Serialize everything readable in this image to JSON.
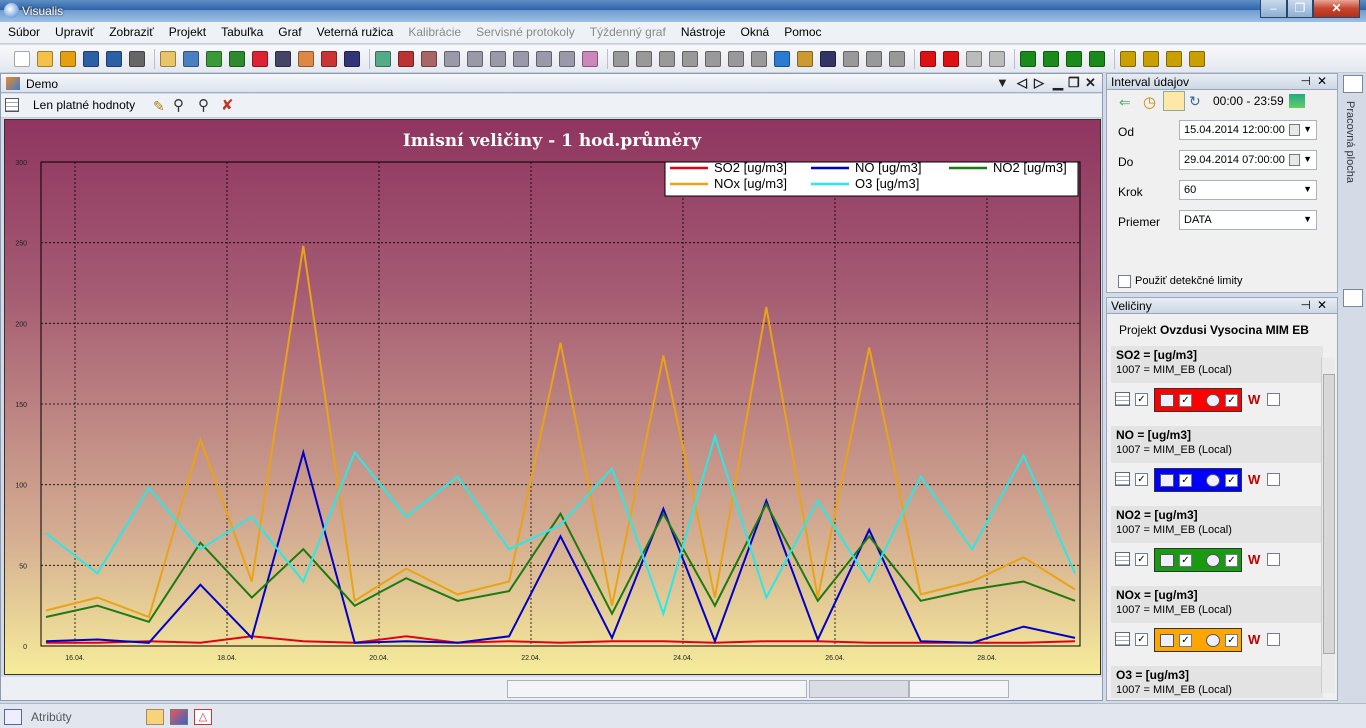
{
  "window": {
    "title": "Visualis"
  },
  "menu": [
    {
      "label": "Súbor",
      "disabled": false
    },
    {
      "label": "Upraviť",
      "disabled": false
    },
    {
      "label": "Zobraziť",
      "disabled": false
    },
    {
      "label": "Projekt",
      "disabled": false
    },
    {
      "label": "Tabuľka",
      "disabled": false
    },
    {
      "label": "Graf",
      "disabled": false
    },
    {
      "label": "Veterná ružica",
      "disabled": false
    },
    {
      "label": "Kalibrácie",
      "disabled": true
    },
    {
      "label": "Servisné protokoly",
      "disabled": true
    },
    {
      "label": "Týždenný graf",
      "disabled": true
    },
    {
      "label": "Nástroje",
      "disabled": false
    },
    {
      "label": "Okná",
      "disabled": false
    },
    {
      "label": "Pomoc",
      "disabled": false
    }
  ],
  "document": {
    "title": "Demo",
    "valid_only_label": "Len platné hodnoty"
  },
  "chart_data": {
    "type": "line",
    "title": "Imisní veličiny - 1 hod.průměry",
    "ylim": [
      0,
      300
    ],
    "yticks": [
      0,
      50,
      100,
      150,
      200,
      250,
      300
    ],
    "xticks": [
      "16.04.",
      "18.04.",
      "20.04.",
      "22.04.",
      "24.04.",
      "26.04.",
      "28.04."
    ],
    "xdomain": [
      "15.04.2014 12:00",
      "29.04.2014 07:00"
    ],
    "x": [
      "15.04.",
      "16.04.",
      "17.04.",
      "17.04.",
      "18.04.",
      "18.04.",
      "19.04.",
      "20.04.",
      "21.04.",
      "22.04.",
      "22.04.",
      "23.04.",
      "23.04.",
      "24.04.",
      "24.04.",
      "25.04.",
      "25.04.",
      "26.04.",
      "27.04.",
      "28.04.",
      "29.04."
    ],
    "grid": true,
    "legend": "top-right",
    "series": [
      {
        "name": "SO2 [ug/m3]",
        "color": "#e3001b",
        "values": [
          2,
          2,
          3,
          2,
          6,
          3,
          2,
          6,
          2,
          3,
          2,
          3,
          3,
          2,
          3,
          3,
          2,
          2,
          2,
          2,
          3
        ]
      },
      {
        "name": "NO [ug/m3]",
        "color": "#0000c8",
        "values": [
          3,
          4,
          2,
          38,
          5,
          120,
          2,
          3,
          2,
          6,
          68,
          5,
          85,
          3,
          90,
          4,
          72,
          3,
          2,
          12,
          5
        ]
      },
      {
        "name": "NO2 [ug/m3]",
        "color": "#1e7a10",
        "values": [
          18,
          25,
          15,
          64,
          30,
          60,
          25,
          42,
          28,
          34,
          82,
          20,
          82,
          25,
          88,
          28,
          68,
          28,
          35,
          40,
          28
        ]
      },
      {
        "name": "NOx [ug/m3]",
        "color": "#e8a317",
        "values": [
          22,
          30,
          18,
          128,
          40,
          248,
          28,
          48,
          32,
          40,
          188,
          25,
          180,
          30,
          210,
          30,
          185,
          32,
          40,
          55,
          35
        ]
      },
      {
        "name": "O3 [ug/m3]",
        "color": "#28e8e8",
        "values": [
          70,
          45,
          98,
          60,
          80,
          40,
          120,
          80,
          105,
          60,
          75,
          110,
          20,
          130,
          30,
          90,
          40,
          105,
          60,
          118,
          45
        ]
      }
    ]
  },
  "interval": {
    "title": "Interval údajov",
    "time_range": "00:00 - 23:59",
    "od_label": "Od",
    "od_value": "15.04.2014 12:00:00",
    "do_label": "Do",
    "do_value": "29.04.2014 07:00:00",
    "krok_label": "Krok",
    "krok_value": "60",
    "priemer_label": "Priemer",
    "priemer_value": "DATA",
    "detect_label": "Použiť detekčné limity"
  },
  "variables": {
    "title": "Veličiny",
    "project_label": "Projekt",
    "project_name": "Ovzdusi Vysocina MIM EB",
    "items": [
      {
        "name": "SO2 =  [ug/m3]",
        "source": "1007 = MIM_EB  (Local)",
        "color": "#ff0000"
      },
      {
        "name": "NO =  [ug/m3]",
        "source": "1007 = MIM_EB  (Local)",
        "color": "#0000ff"
      },
      {
        "name": "NO2 =  [ug/m3]",
        "source": "1007 = MIM_EB  (Local)",
        "color": "#1a9a10"
      },
      {
        "name": "NOx =  [ug/m3]",
        "source": "1007 = MIM_EB  (Local)",
        "color": "#ffa500"
      },
      {
        "name": "O3 =  [ug/m3]",
        "source": "1007 = MIM_EB  (Local)",
        "color": "#00e8e8"
      }
    ]
  },
  "side_tab": {
    "label": "Pracovná plocha"
  },
  "status": {
    "attributes_label": "Atribúty"
  }
}
